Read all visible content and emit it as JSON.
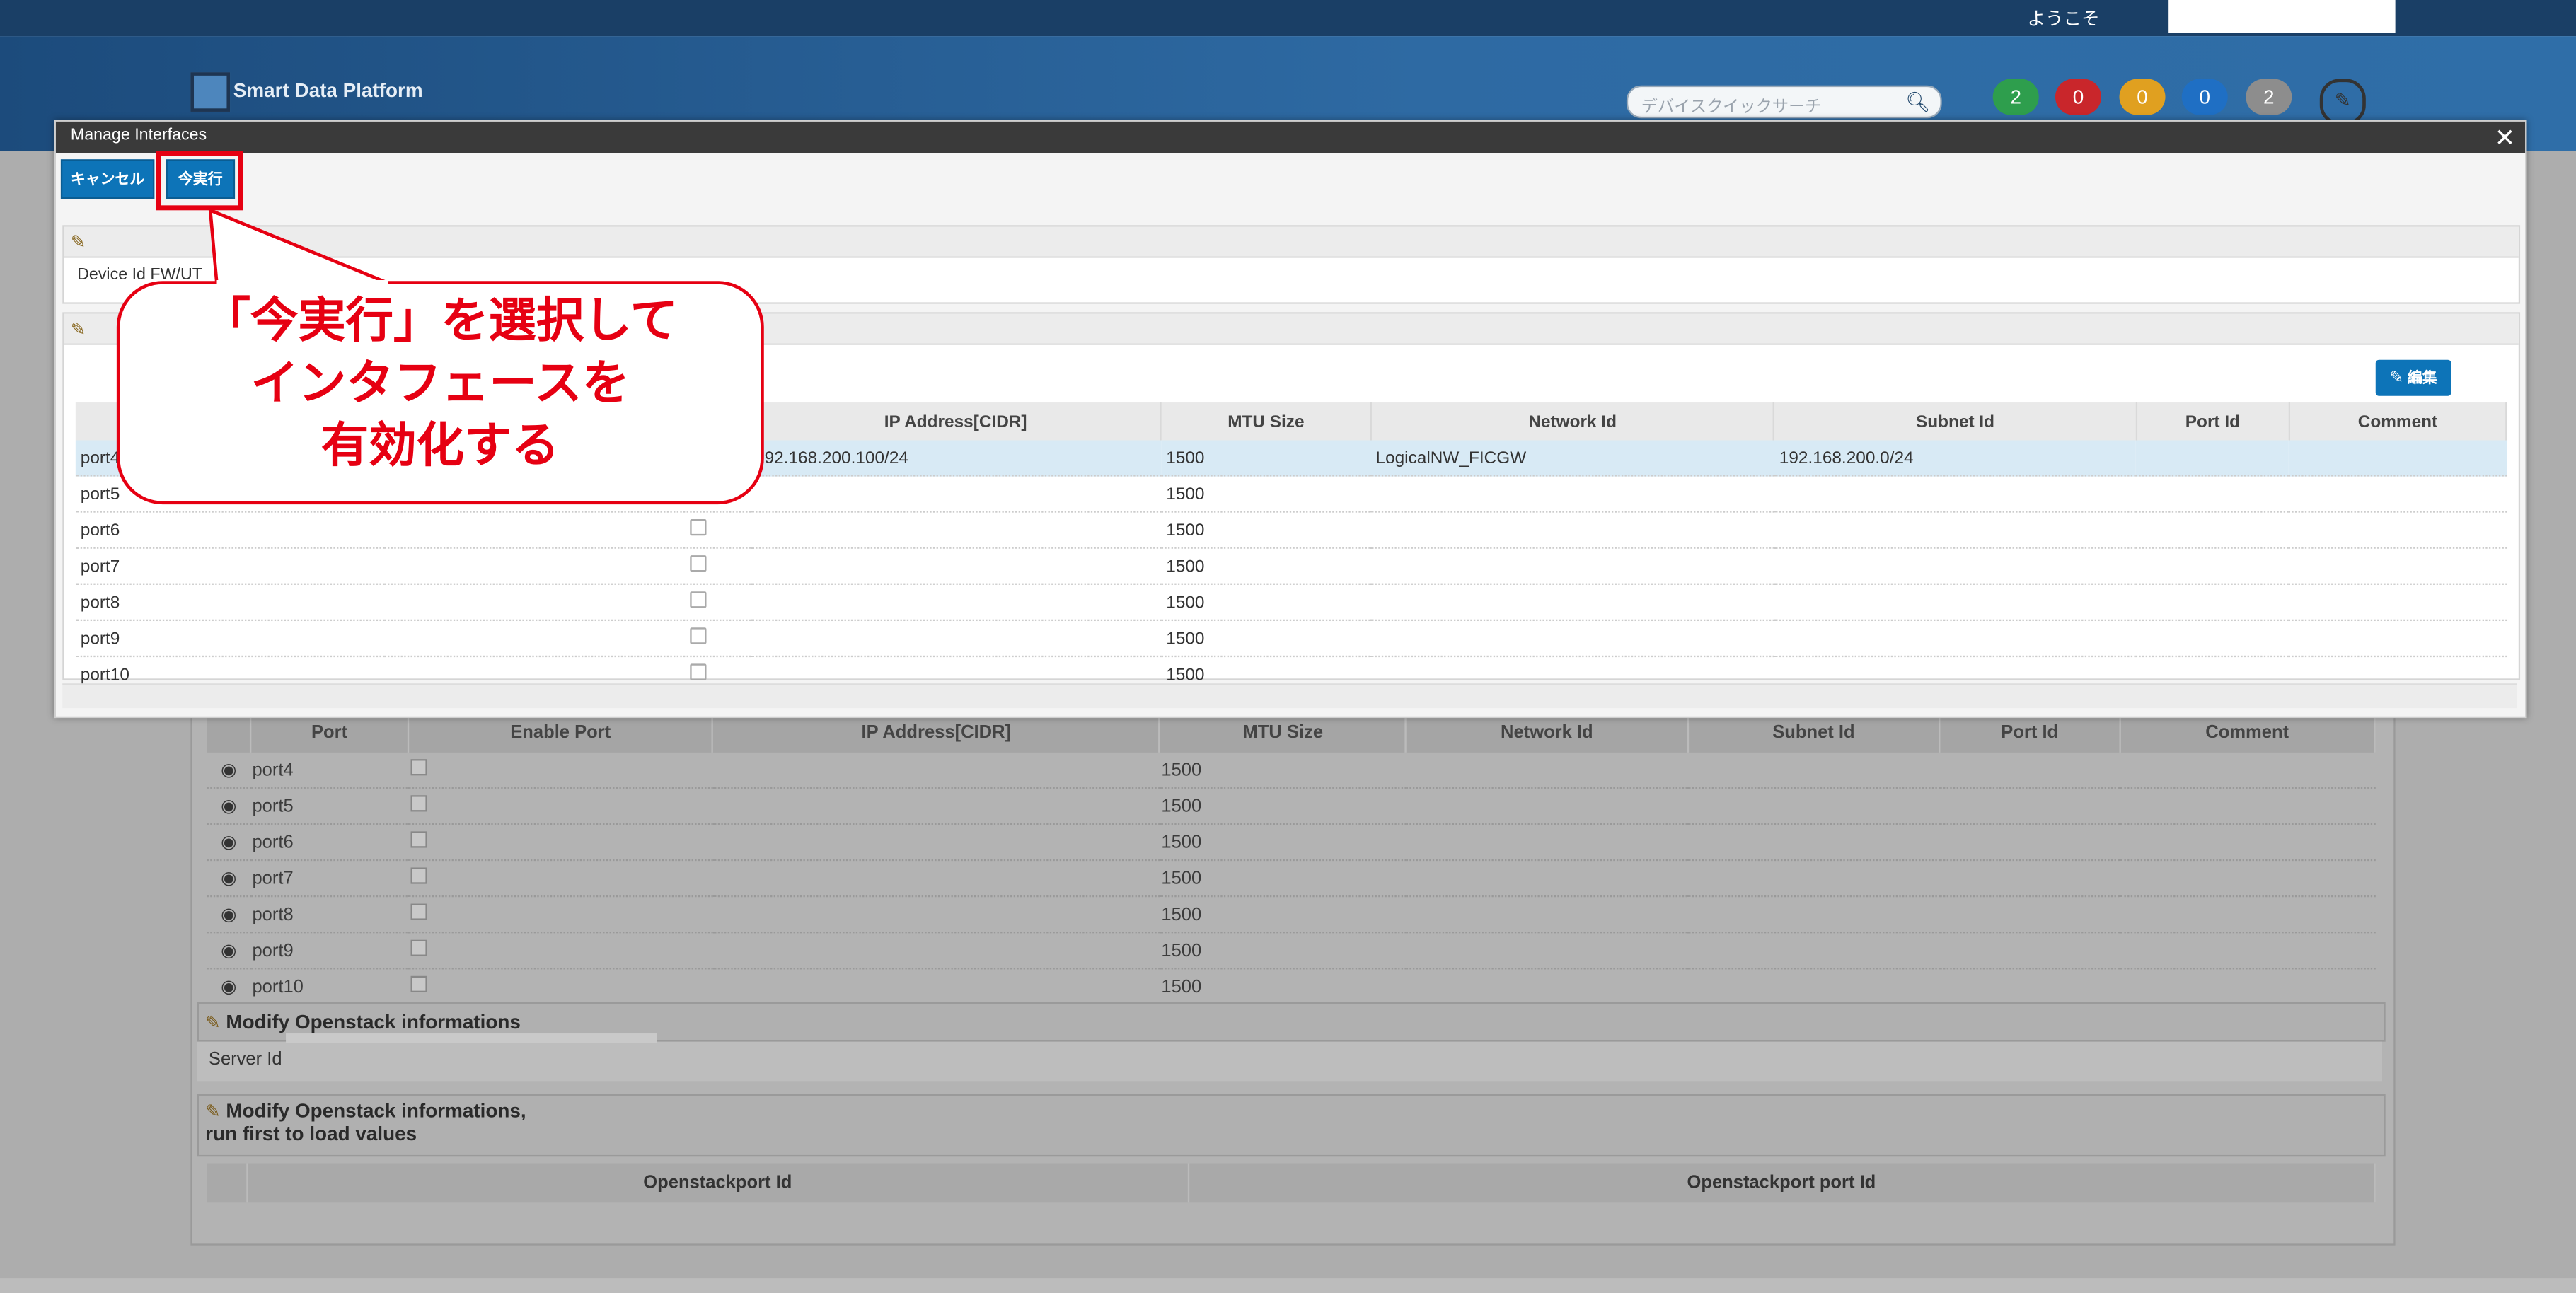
{
  "header": {
    "welcome": "ようこそ",
    "logo_text": "Smart Data Platform",
    "search_placeholder": "デバイスクイックサーチ",
    "badges": [
      {
        "value": "2",
        "color": "#2e9e4d"
      },
      {
        "value": "0",
        "color": "#c9262b"
      },
      {
        "value": "0",
        "color": "#e0a020"
      },
      {
        "value": "0",
        "color": "#1f6fc4"
      },
      {
        "value": "2",
        "color": "#8d8d8d"
      }
    ]
  },
  "background": {
    "columns": [
      "Port",
      "Enable Port",
      "IP Address[CIDR]",
      "MTU Size",
      "Network Id",
      "Subnet Id",
      "Port Id",
      "Comment"
    ],
    "rows": [
      {
        "port": "port4",
        "mtu": "1500"
      },
      {
        "port": "port5",
        "mtu": "1500"
      },
      {
        "port": "port6",
        "mtu": "1500"
      },
      {
        "port": "port7",
        "mtu": "1500"
      },
      {
        "port": "port8",
        "mtu": "1500"
      },
      {
        "port": "port9",
        "mtu": "1500"
      },
      {
        "port": "port10",
        "mtu": "1500"
      }
    ],
    "modify_openstack": "Modify Openstack informations",
    "server_id_label": "Server Id",
    "modify_openstack_run_first_1": "Modify Openstack informations,",
    "modify_openstack_run_first_2": "run first to load values",
    "os_columns": [
      "Openstackport Id",
      "Openstackport port Id"
    ]
  },
  "modal": {
    "title": "Manage Interfaces",
    "cancel_label": "キャンセル",
    "run_now_label": "今実行",
    "device_id_label": "Device Id",
    "device_id_value": "FW/UT",
    "edit_label": "編集",
    "columns": [
      "IP Address[CIDR]",
      "MTU Size",
      "Network Id",
      "Subnet Id",
      "Port Id",
      "Comment"
    ],
    "rows": [
      {
        "port": "port4",
        "ip": "192.168.200.100/24",
        "mtu": "1500",
        "network": "LogicalNW_FICGW",
        "subnet": "192.168.200.0/24",
        "selected": true,
        "checkbox": false
      },
      {
        "port": "port5",
        "ip": "",
        "mtu": "1500",
        "network": "",
        "subnet": "",
        "selected": false,
        "checkbox": false
      },
      {
        "port": "port6",
        "ip": "",
        "mtu": "1500",
        "network": "",
        "subnet": "",
        "selected": false,
        "checkbox": true
      },
      {
        "port": "port7",
        "ip": "",
        "mtu": "1500",
        "network": "",
        "subnet": "",
        "selected": false,
        "checkbox": true
      },
      {
        "port": "port8",
        "ip": "",
        "mtu": "1500",
        "network": "",
        "subnet": "",
        "selected": false,
        "checkbox": true
      },
      {
        "port": "port9",
        "ip": "",
        "mtu": "1500",
        "network": "",
        "subnet": "",
        "selected": false,
        "checkbox": true
      },
      {
        "port": "port10",
        "ip": "",
        "mtu": "1500",
        "network": "",
        "subnet": "",
        "selected": false,
        "checkbox": true
      }
    ]
  },
  "callout": {
    "line1": "「今実行」を選択して",
    "line2": "インタフェースを",
    "line3": "有効化する"
  }
}
